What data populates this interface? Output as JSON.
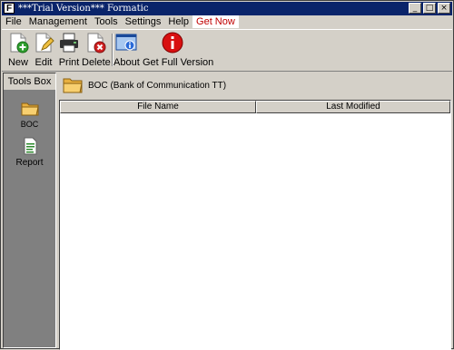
{
  "window": {
    "title": "***Trial Version*** Formatic",
    "app_icon_letter": "F",
    "controls": {
      "minimize": "_",
      "maximize": "□",
      "close": "×"
    }
  },
  "menu": [
    "File",
    "Management",
    "Tools",
    "Settings",
    "Help",
    "Get Now"
  ],
  "toolbar": {
    "buttons": [
      {
        "label": "New",
        "icon": "new-document-icon"
      },
      {
        "label": "Edit",
        "icon": "edit-document-icon"
      },
      {
        "label": "Print",
        "icon": "printer-icon"
      },
      {
        "label": "Delete",
        "icon": "delete-document-icon"
      },
      {
        "label": "About",
        "icon": "about-info-icon"
      },
      {
        "label": "Get Full Version",
        "icon": "info-red-icon"
      }
    ]
  },
  "tools_box": {
    "title": "Tools Box",
    "items": [
      {
        "label": "BOC",
        "icon": "folder-icon"
      },
      {
        "label": "Report",
        "icon": "report-icon"
      }
    ]
  },
  "main": {
    "path": "BOC (Bank of Communication TT)",
    "columns": [
      "File Name",
      "Last Modified"
    ],
    "rows": []
  },
  "colors": {
    "title_bar": "#0a246a",
    "get_now_text": "#c00000",
    "workspace": "#d4d0c8"
  }
}
